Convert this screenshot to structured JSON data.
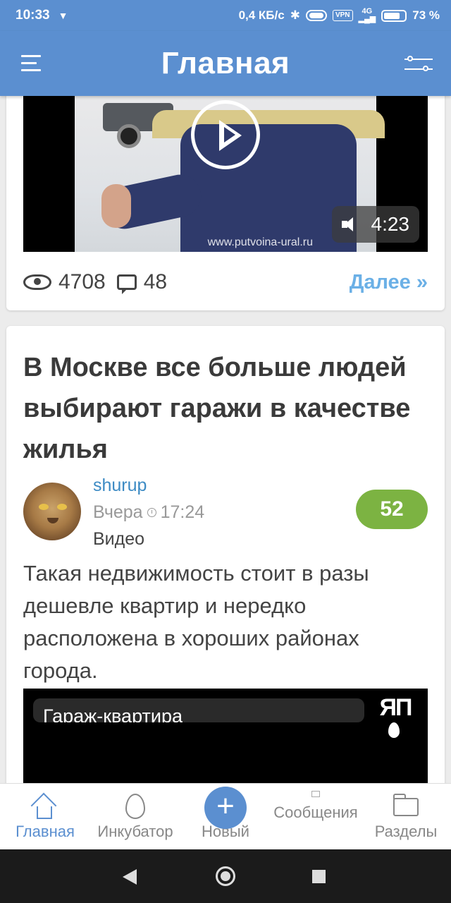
{
  "status_bar": {
    "time": "10:33",
    "speed": "0,4 КБ/с",
    "vpn": "VPN",
    "network": "4G",
    "battery": "73 %"
  },
  "header": {
    "title": "Главная"
  },
  "post1": {
    "video_watermark": "www.putvoina-ural.ru",
    "duration": "4:23",
    "views": "4708",
    "comments": "48",
    "more": "Далее »"
  },
  "post2": {
    "title": "В Москве все больше людей выбирают гаражи в качестве жилья",
    "author": "shurup",
    "date": "Вчера",
    "time": "17:24",
    "category": "Видео",
    "rating": "52",
    "excerpt": "Такая недвижимость стоит в разы дешевле квартир и нередко расположена в хороших районах города.",
    "video_caption": "Гараж-квартира",
    "video_logo": "ЯП"
  },
  "bottom_nav": {
    "items": [
      {
        "label": "Главная",
        "icon": "home-icon"
      },
      {
        "label": "Инкубатор",
        "icon": "egg-icon"
      },
      {
        "label": "Новый",
        "icon": "plus-icon"
      },
      {
        "label": "Сообщения",
        "icon": "mail-icon"
      },
      {
        "label": "Разделы",
        "icon": "folder-icon"
      }
    ]
  },
  "colors": {
    "brand": "#5b8fd0",
    "link": "#6bb0e6",
    "author": "#3d8bc4",
    "rating": "#7cb342"
  }
}
